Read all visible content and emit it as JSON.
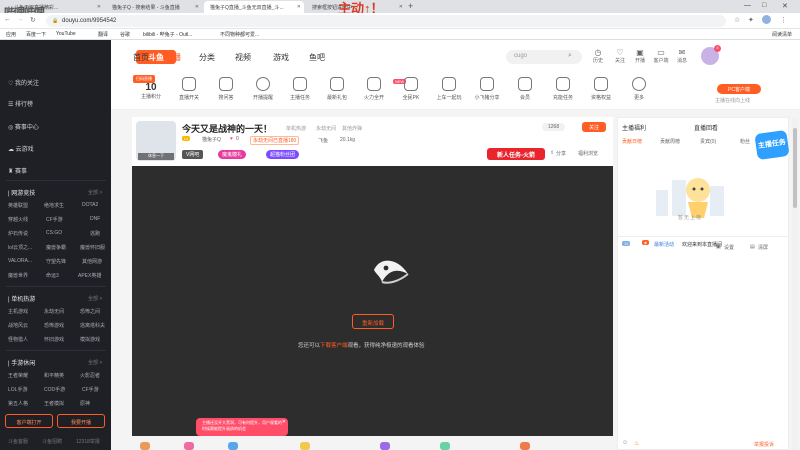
{
  "browser": {
    "tabs": [
      {
        "title": "斗鱼无双直播精彩..."
      },
      {
        "title": "猫兔子Q - 搜索结果 - 斗鱼直播"
      },
      {
        "title": "猫兔子Q直播_斗鱼无双直播_斗..."
      },
      {
        "title": "搜索框按钮进度中..."
      }
    ],
    "tab_overlay_text": "主动↑！",
    "watermark": "哔哩哔哩",
    "url": "douyu.com/9954542",
    "bookmarks": [
      "应用",
      "百度一下",
      "YouTube",
      "翻译",
      "谷歌",
      "bilibili - 哔兔子 - Outl...",
      "不同物种都可爱...",
      "阅读清单"
    ]
  },
  "sidebar": {
    "top_items": [
      "我的关注",
      "排行榜",
      "赛事中心",
      "云游戏",
      "赛事"
    ],
    "sections": [
      {
        "title": "| 网游竞技",
        "more": "全部 >",
        "items": [
          "英雄联盟",
          "绝地求生",
          "DOTA2",
          "穿越火线",
          "CF手游",
          "DNF",
          "炉石传说",
          "CS:GO",
          "逃跑",
          "lol云顶之...",
          "魔兽争霸",
          "魔兽怀旧服",
          "VALORA...",
          "守望先锋",
          "其他网游",
          "魔兽世界",
          "命运3",
          "APEX英雄"
        ]
      },
      {
        "title": "| 单机热游",
        "more": "全部 >",
        "items": [
          "主机游戏",
          "永劫无间",
          "恐怖之间",
          "战地风云",
          "恐怖游戏",
          "逃离塔科夫",
          "怪物猎人",
          "怀旧游戏",
          "模拟游戏"
        ]
      },
      {
        "title": "| 手游休闲",
        "more": "全部 >",
        "items": [
          "王者荣耀",
          "和平精英",
          "火影忍者",
          "LOL手游",
          "COD手游",
          "CF手游",
          "第五人格",
          "王者模拟",
          "原神"
        ]
      }
    ],
    "bottom_buttons": [
      "客户端打开",
      "我要开播"
    ],
    "footer": [
      "斗鱼客服",
      "斗鱼招聘",
      "12318举报"
    ]
  },
  "topnav": {
    "logo": "斗鱼",
    "items": [
      "首页",
      "直播",
      "分类",
      "视频",
      "游戏",
      "鱼吧"
    ],
    "search_placeholder": "cugo",
    "icons": [
      "历史",
      "关注",
      "开播",
      "客户端",
      "消息"
    ],
    "badge_count": "4"
  },
  "categories": [
    {
      "label": "主播积分",
      "value": "10"
    },
    {
      "label": "直播开关"
    },
    {
      "label": "搜问答"
    },
    {
      "label": "开播提醒"
    },
    {
      "label": "主播任务"
    },
    {
      "label": "最新礼包"
    },
    {
      "label": "火力全开",
      "badge": "NEW"
    },
    {
      "label": "全民PK"
    },
    {
      "label": "上车一起玩"
    },
    {
      "label": "小飞猪分享"
    },
    {
      "label": "会员"
    },
    {
      "label": "充能任务"
    },
    {
      "label": "资格权益"
    },
    {
      "label": "更多"
    }
  ],
  "cats_tag": "扫码直播",
  "pc_client": {
    "label": "PC客户端",
    "sub": "主播在线向上线"
  },
  "room": {
    "title": "今天又是战神的一天！",
    "streamer": "猫兔子Q",
    "hot": "0",
    "tags": [
      "单机热游",
      "永劫无间",
      "其他炸弹"
    ],
    "live_status": "未开播",
    "online_fans": "永劫无间已直播180",
    "location": "飞鱼",
    "weight": "20.1kg",
    "fans_count": "1268",
    "follow_label": "关注",
    "badges": [
      "V网吧",
      "魔鬼糖礼",
      "超猫粉丝团"
    ],
    "new_task": "新人任务-火箭",
    "share": "分享",
    "report": "福利浏览",
    "avatar_caption": "休息一下"
  },
  "player": {
    "reload_button": "重新加载",
    "tip_prefix": "您还可以",
    "tip_link": "下载客户端",
    "tip_suffix": "观看，获得纯净极速的观看体验",
    "toast": "主播还没开大黑洞，可有何提升，用户观看的时候赛能提升画质的机会"
  },
  "chat": {
    "tabs": [
      "主播福利",
      "直播回看"
    ],
    "subtabs": [
      "贡献日榜",
      "贡献周榜",
      "贵宾(0)",
      "粉丝"
    ],
    "empty_text": "暂无上榜",
    "msg_level": "12",
    "msg_user": "最新活动",
    "msg_text": "欢迎来到本直播间",
    "setting": "设置",
    "clear": "清屏",
    "badge_label": "主播任务",
    "report_label": "举报投诉"
  },
  "colors": {
    "accent": "#ff5d23",
    "sidebar_bg": "#1e2026",
    "player_bg": "#2d2d2d",
    "pink": "#ff4d6a",
    "purple": "#7b4bff"
  }
}
